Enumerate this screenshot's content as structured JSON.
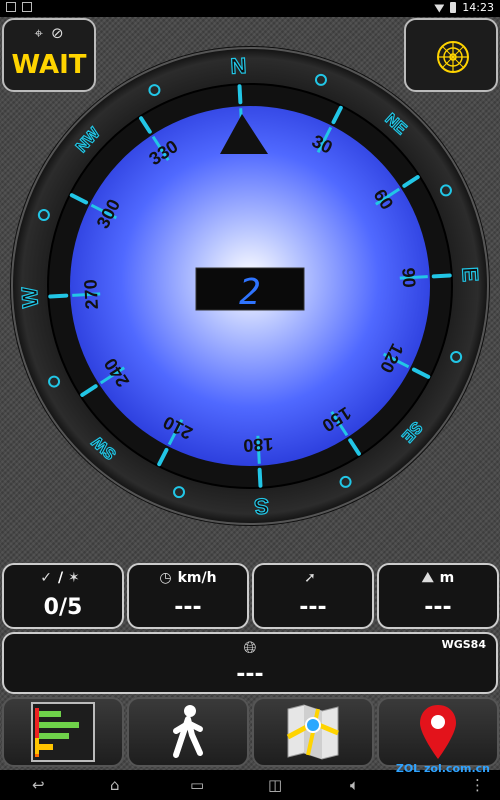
{
  "status_bar": {
    "time": "14:23"
  },
  "wait_button": {
    "label": "WAIT"
  },
  "compass": {
    "heading": "2",
    "cardinals": [
      "N",
      "NE",
      "E",
      "SE",
      "S",
      "SW",
      "W",
      "NW"
    ],
    "degree_labels": [
      "30",
      "60",
      "90",
      "120",
      "150",
      "180",
      "210",
      "240",
      "270",
      "300",
      "330"
    ]
  },
  "satellites": {
    "value": "0/5"
  },
  "speed": {
    "unit": "km/h",
    "value": "---"
  },
  "bearing": {
    "value": "---"
  },
  "altitude": {
    "unit": "m",
    "value": "---"
  },
  "coordinates": {
    "datum": "WGS84",
    "value": "---"
  },
  "watermark": "ZOL zol.com.cn",
  "colors": {
    "wait_text": "#ffd400",
    "compass_blue": "#3f56ff",
    "accent_cyan": "#22c6e6",
    "pin_red": "#e3131b"
  }
}
